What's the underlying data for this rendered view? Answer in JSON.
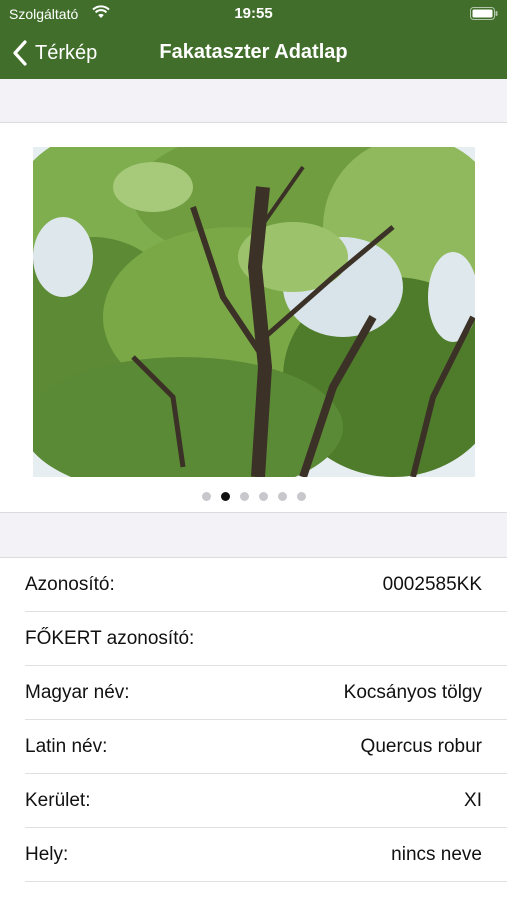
{
  "status_bar": {
    "carrier": "Szolgáltató",
    "time": "19:55",
    "icons": [
      "wifi-icon",
      "battery-icon"
    ]
  },
  "nav": {
    "back_label": "Térkép",
    "back_icon": "chevron-left-icon",
    "title": "Fakataszter Adatlap"
  },
  "colors": {
    "nav_background": "#416f2b",
    "page_background": "#f2f2f7",
    "active_dot": "#111111",
    "inactive_dot": "#c7c7cc"
  },
  "gallery": {
    "page_count": 6,
    "current_page": 2
  },
  "details": {
    "rows": [
      {
        "label": "Azonosító:",
        "value": "0002585KK"
      },
      {
        "label": "FŐKERT azonosító:",
        "value": ""
      },
      {
        "label": "Magyar név:",
        "value": "Kocsányos tölgy"
      },
      {
        "label": "Latin név:",
        "value": "Quercus robur"
      },
      {
        "label": "Kerület:",
        "value": "XI"
      },
      {
        "label": "Hely:",
        "value": "nincs neve"
      },
      {
        "label": "",
        "value": ""
      }
    ]
  }
}
